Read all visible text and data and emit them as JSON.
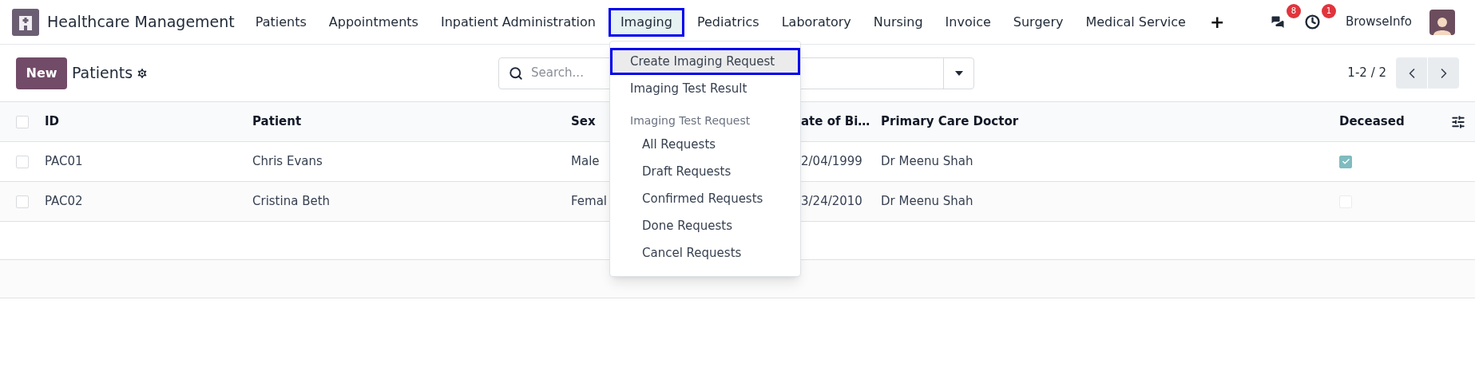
{
  "navbar": {
    "app_title": "Healthcare Management",
    "menu": [
      {
        "label": "Patients",
        "selected": false
      },
      {
        "label": "Appointments",
        "selected": false
      },
      {
        "label": "Inpatient Administration",
        "selected": false
      },
      {
        "label": "Imaging",
        "selected": true
      },
      {
        "label": "Pediatrics",
        "selected": false
      },
      {
        "label": "Laboratory",
        "selected": false
      },
      {
        "label": "Nursing",
        "selected": false
      },
      {
        "label": "Invoice",
        "selected": false
      },
      {
        "label": "Surgery",
        "selected": false
      },
      {
        "label": "Medical Service",
        "selected": false
      }
    ],
    "add_label": "+",
    "messages_count": "8",
    "activities_count": "1",
    "company": "BrowseInfo"
  },
  "dropdown": {
    "items": [
      {
        "kind": "item",
        "label": "Create Imaging Request",
        "selected": true
      },
      {
        "kind": "item",
        "label": "Imaging Test Result",
        "selected": false
      },
      {
        "kind": "header",
        "label": "Imaging Test Request",
        "selected": false
      },
      {
        "kind": "subitem",
        "label": "All Requests",
        "selected": false
      },
      {
        "kind": "subitem",
        "label": "Draft Requests",
        "selected": false
      },
      {
        "kind": "subitem",
        "label": "Confirmed Requests",
        "selected": false
      },
      {
        "kind": "subitem",
        "label": "Done Requests",
        "selected": false
      },
      {
        "kind": "subitem",
        "label": "Cancel Requests",
        "selected": false
      }
    ]
  },
  "control_panel": {
    "new_button": "New",
    "breadcrumb": "Patients",
    "search": {
      "placeholder": "Search..."
    },
    "pager": "1-2 / 2"
  },
  "table": {
    "all_checked": false,
    "columns": [
      "ID",
      "Patient",
      "Sex",
      "ate of Bi…",
      "Primary Care Doctor",
      "Deceased"
    ],
    "rows": [
      {
        "cells": [
          "PAC01",
          "Chris Evans",
          "Male",
          "2/04/1999",
          "Dr Meenu Shah"
        ],
        "deceased": true,
        "checked": false
      },
      {
        "cells": [
          "PAC02",
          "Cristina Beth",
          "Femal",
          "3/24/2010",
          "Dr Meenu Shah"
        ],
        "deceased": false,
        "checked": false
      }
    ]
  }
}
